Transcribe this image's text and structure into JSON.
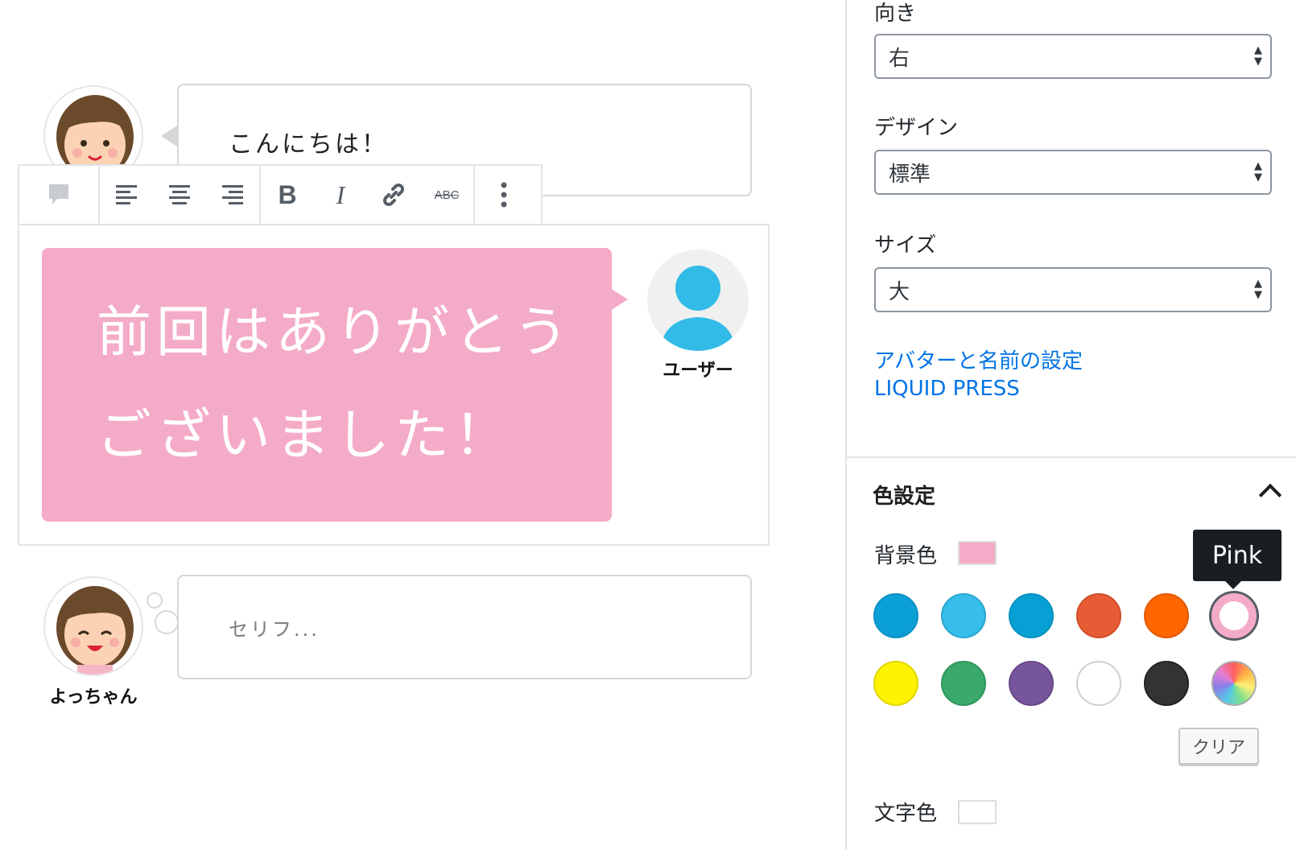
{
  "blocks": {
    "top": {
      "text": "こんにちは！"
    },
    "selected": {
      "text_line1": "前回はありがとう",
      "text_line2": "ございました！",
      "avatar_name": "ユーザー",
      "bg_color": "#f4abc8"
    },
    "bottom": {
      "placeholder": "セリフ...",
      "avatar_name": "よっちゃん"
    }
  },
  "toolbar": {
    "bold": "B",
    "italic": "I",
    "strike": "ABC"
  },
  "sidebar": {
    "direction": {
      "label": "向き",
      "value": "右"
    },
    "design": {
      "label": "デザイン",
      "value": "標準"
    },
    "size": {
      "label": "サイズ",
      "value": "大"
    },
    "links": [
      "アバターと名前の設定",
      "LIQUID PRESS"
    ],
    "color_panel": {
      "title": "色設定",
      "bg_label": "背景色",
      "text_label": "文字色",
      "tooltip": "Pink",
      "clear": "クリア",
      "bg_current": "#f4abc8",
      "text_current": "#ffffff",
      "palette": [
        "#0aa0d6",
        "#36bdea",
        "#06a0d4",
        "#e85c35",
        "#ff6600",
        "#f4abc8",
        "#fff200",
        "#3aaa6a",
        "#77559c",
        "#ffffff",
        "#333333",
        "gradient"
      ]
    }
  }
}
